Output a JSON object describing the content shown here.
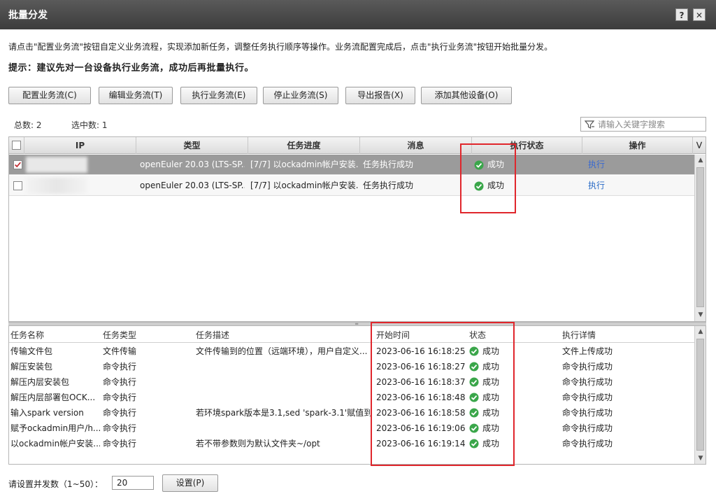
{
  "window": {
    "title": "批量分发",
    "help_label": "?",
    "close_label": "✕"
  },
  "instructions": {
    "description": "请点击\"配置业务流\"按钮自定义业务流程，实现添加新任务，调整任务执行顺序等操作。业务流配置完成后，点击\"执行业务流\"按钮开始批量分发。",
    "hint": "提示：建议先对一台设备执行业务流，成功后再批量执行。"
  },
  "toolbar": {
    "buttons": [
      {
        "label": "配置业务流(C)"
      },
      {
        "label": "编辑业务流(T)"
      },
      {
        "label": "执行业务流(E)"
      },
      {
        "label": "停止业务流(S)"
      },
      {
        "label": "导出报告(X)"
      },
      {
        "label": "添加其他设备(O)"
      }
    ]
  },
  "summary": {
    "total_label": "总数:",
    "total_value": "2",
    "selected_label": "选中数:",
    "selected_value": "1"
  },
  "search": {
    "placeholder": "请输入关键字搜索",
    "icon": "filter-icon"
  },
  "devices": {
    "columns": [
      "IP",
      "类型",
      "任务进度",
      "消息",
      "执行状态",
      "操作"
    ],
    "rows": [
      {
        "ip": "",
        "type": "openEuler 20.03 (LTS-SP...",
        "progress": "[7/7] 以ockadmin帐户安装...",
        "message": "任务执行成功",
        "status": "成功",
        "action": "执行",
        "checked": true,
        "selected": true
      },
      {
        "ip": "",
        "type": "openEuler 20.03 (LTS-SP...",
        "progress": "[7/7] 以ockadmin帐户安装...",
        "message": "任务执行成功",
        "status": "成功",
        "action": "执行",
        "checked": false,
        "selected": false
      }
    ]
  },
  "tasks": {
    "columns": [
      "任务名称",
      "任务类型",
      "任务描述",
      "开始时间",
      "状态",
      "执行详情"
    ],
    "rows": [
      {
        "name": "传输文件包",
        "type": "文件传输",
        "desc": "文件传输到的位置（远端环境），用户自定义...",
        "start": "2023-06-16 16:18:25",
        "status": "成功",
        "detail": "文件上传成功"
      },
      {
        "name": "解压安装包",
        "type": "命令执行",
        "desc": "",
        "start": "2023-06-16 16:18:27",
        "status": "成功",
        "detail": "命令执行成功"
      },
      {
        "name": "解压内层安装包",
        "type": "命令执行",
        "desc": "",
        "start": "2023-06-16 16:18:37",
        "status": "成功",
        "detail": "命令执行成功"
      },
      {
        "name": "解压内层部署包OCK...",
        "type": "命令执行",
        "desc": "",
        "start": "2023-06-16 16:18:48",
        "status": "成功",
        "detail": "命令执行成功"
      },
      {
        "name": "输入spark version",
        "type": "命令执行",
        "desc": "若环境spark版本是3.1,sed 'spark-3.1'赋值到...",
        "start": "2023-06-16 16:18:58",
        "status": "成功",
        "detail": "命令执行成功"
      },
      {
        "name": "赋予ockadmin用户/h...",
        "type": "命令执行",
        "desc": "",
        "start": "2023-06-16 16:19:06",
        "status": "成功",
        "detail": "命令执行成功"
      },
      {
        "name": "以ockadmin帐户安装...",
        "type": "命令执行",
        "desc": "若不带参数则为默认文件夹~/opt",
        "start": "2023-06-16 16:19:14",
        "status": "成功",
        "detail": "命令执行成功"
      }
    ]
  },
  "footer": {
    "concurrency_label": "请设置并发数（1~50）：",
    "concurrency_value": "20",
    "set_label": "设置(P)"
  },
  "colors": {
    "success": "#3aa64a",
    "highlight_box": "#e0262c",
    "link": "#2a6bc6",
    "selected_row": "#9b9b9b"
  }
}
